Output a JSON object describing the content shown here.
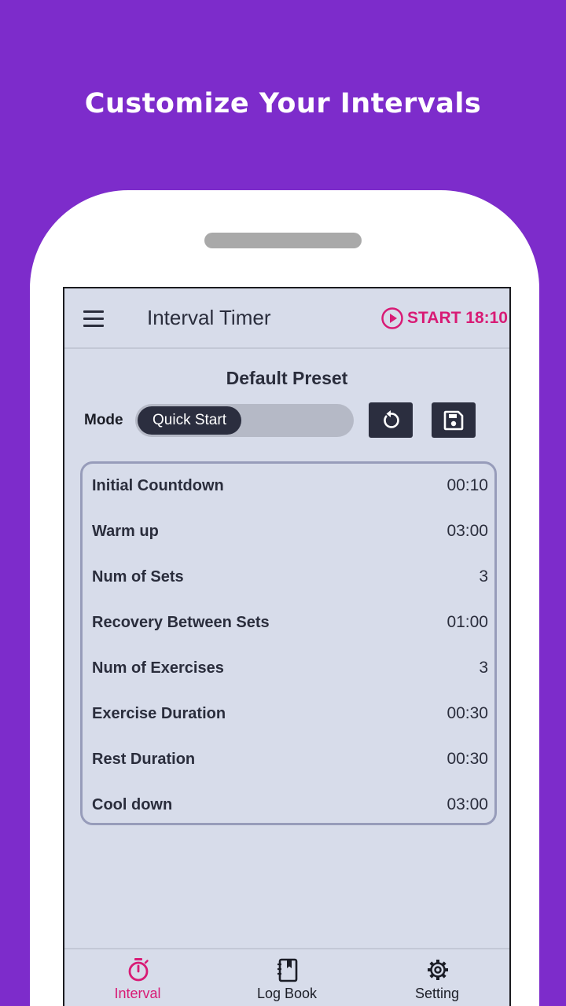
{
  "promo": {
    "headline": "Customize Your Intervals"
  },
  "app": {
    "title": "Interval Timer",
    "start_label": "START 18:10",
    "accent_color": "#d81b75",
    "background_color": "#7d2ccb",
    "menu_icon": "hamburger-menu-icon",
    "start_icon": "play-circle-icon"
  },
  "preset": {
    "title": "Default Preset",
    "mode_label": "Mode",
    "mode_value": "Quick Start",
    "reset_icon": "reset-icon",
    "save_icon": "save-icon"
  },
  "settings": [
    {
      "label": "Initial Countdown",
      "value": "00:10"
    },
    {
      "label": "Warm up",
      "value": "03:00"
    },
    {
      "label": "Num of Sets",
      "value": "3"
    },
    {
      "label": "Recovery Between Sets",
      "value": "01:00"
    },
    {
      "label": "Num of Exercises",
      "value": "3"
    },
    {
      "label": "Exercise Duration",
      "value": "00:30"
    },
    {
      "label": "Rest Duration",
      "value": "00:30"
    },
    {
      "label": "Cool down",
      "value": "03:00"
    }
  ],
  "nav": [
    {
      "label": "Interval",
      "icon": "stopwatch-icon",
      "active": true
    },
    {
      "label": "Log Book",
      "icon": "notebook-icon",
      "active": false
    },
    {
      "label": "Setting",
      "icon": "gear-icon",
      "active": false
    }
  ]
}
